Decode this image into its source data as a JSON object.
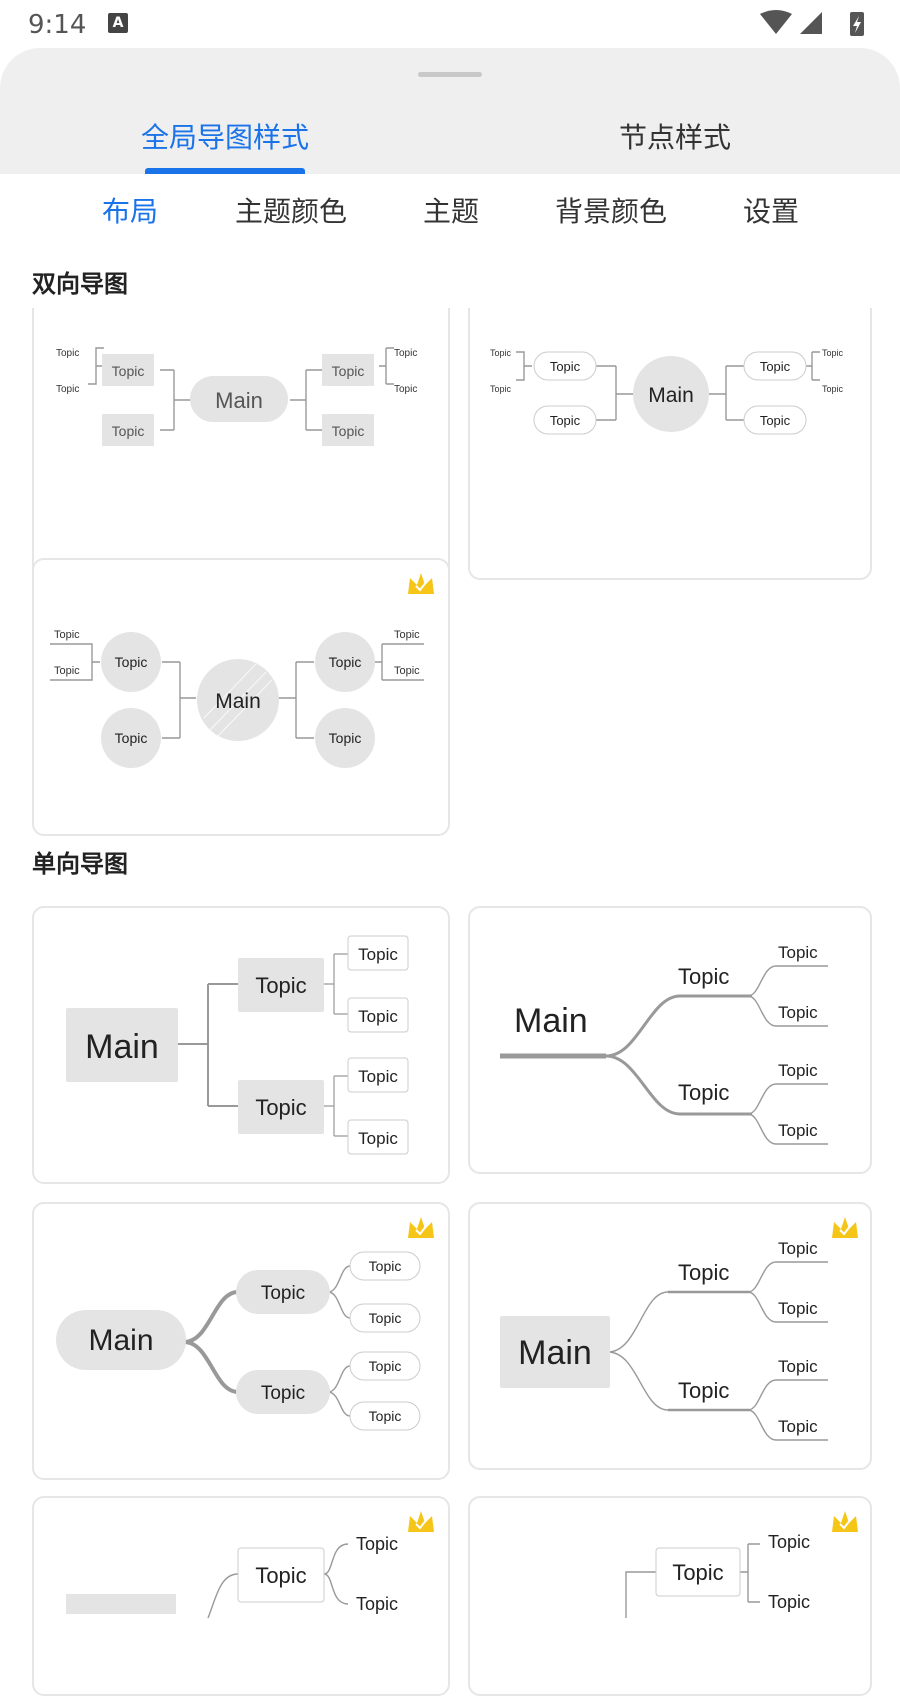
{
  "status_bar": {
    "time": "9:14",
    "keyboard_indicator": "A"
  },
  "tabs": {
    "global": "全局导图样式",
    "node": "节点样式"
  },
  "subtabs": [
    "布局",
    "主题颜色",
    "主题",
    "背景颜色",
    "设置"
  ],
  "sections": {
    "bidirectional": "双向导图",
    "unidirectional": "单向导图"
  },
  "node_text": {
    "main": "Main",
    "topic": "Topic"
  },
  "colors": {
    "accent": "#1a73e8",
    "node_fill": "#e4e4e4",
    "crown": "#f5c518"
  }
}
